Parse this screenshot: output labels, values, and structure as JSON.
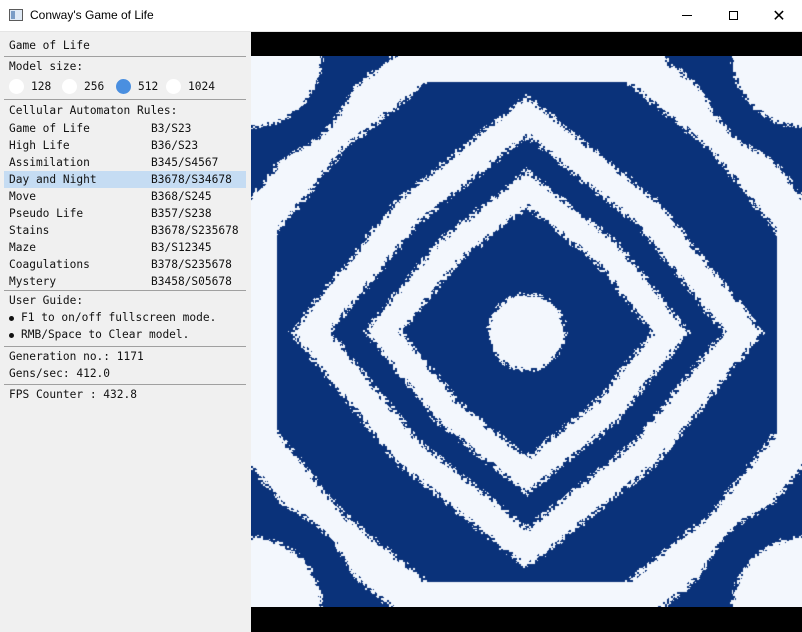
{
  "window": {
    "title": "Conway's Game of Life"
  },
  "panel": {
    "header": "Game of Life",
    "model_size": {
      "label": "Model size:",
      "options": [
        "128",
        "256",
        "512",
        "1024"
      ],
      "selected": "512"
    },
    "rules": {
      "label": "Cellular Automaton Rules:",
      "items": [
        {
          "name": "Game of Life",
          "code": "B3/S23"
        },
        {
          "name": "High Life",
          "code": "B36/S23"
        },
        {
          "name": "Assimilation",
          "code": "B345/S4567"
        },
        {
          "name": "Day and Night",
          "code": "B3678/S34678"
        },
        {
          "name": "Move",
          "code": "B368/S245"
        },
        {
          "name": "Pseudo Life",
          "code": "B357/S238"
        },
        {
          "name": "Stains",
          "code": "B3678/S235678"
        },
        {
          "name": "Maze",
          "code": "B3/S12345"
        },
        {
          "name": "Coagulations",
          "code": "B378/S235678"
        },
        {
          "name": "Mystery",
          "code": "B3458/S05678"
        }
      ],
      "selected": "Day and Night"
    },
    "guide": {
      "label": "User Guide:",
      "items": [
        "F1 to on/off fullscreen mode.",
        "RMB/Space to Clear model."
      ]
    },
    "stats": {
      "generation": "Generation no.: 1171",
      "gens_per_sec": "Gens/sec: 412.0",
      "fps": "FPS Counter : 432.8"
    }
  },
  "colors": {
    "cell": "#0a327a",
    "background": "#f3f7fd",
    "selection": "#c5dcf3",
    "radio_checked": "#4a8fe0"
  },
  "icons": {
    "app": "window-icon",
    "minimize": "minimize-icon",
    "maximize": "maximize-icon",
    "close": "close-icon"
  }
}
